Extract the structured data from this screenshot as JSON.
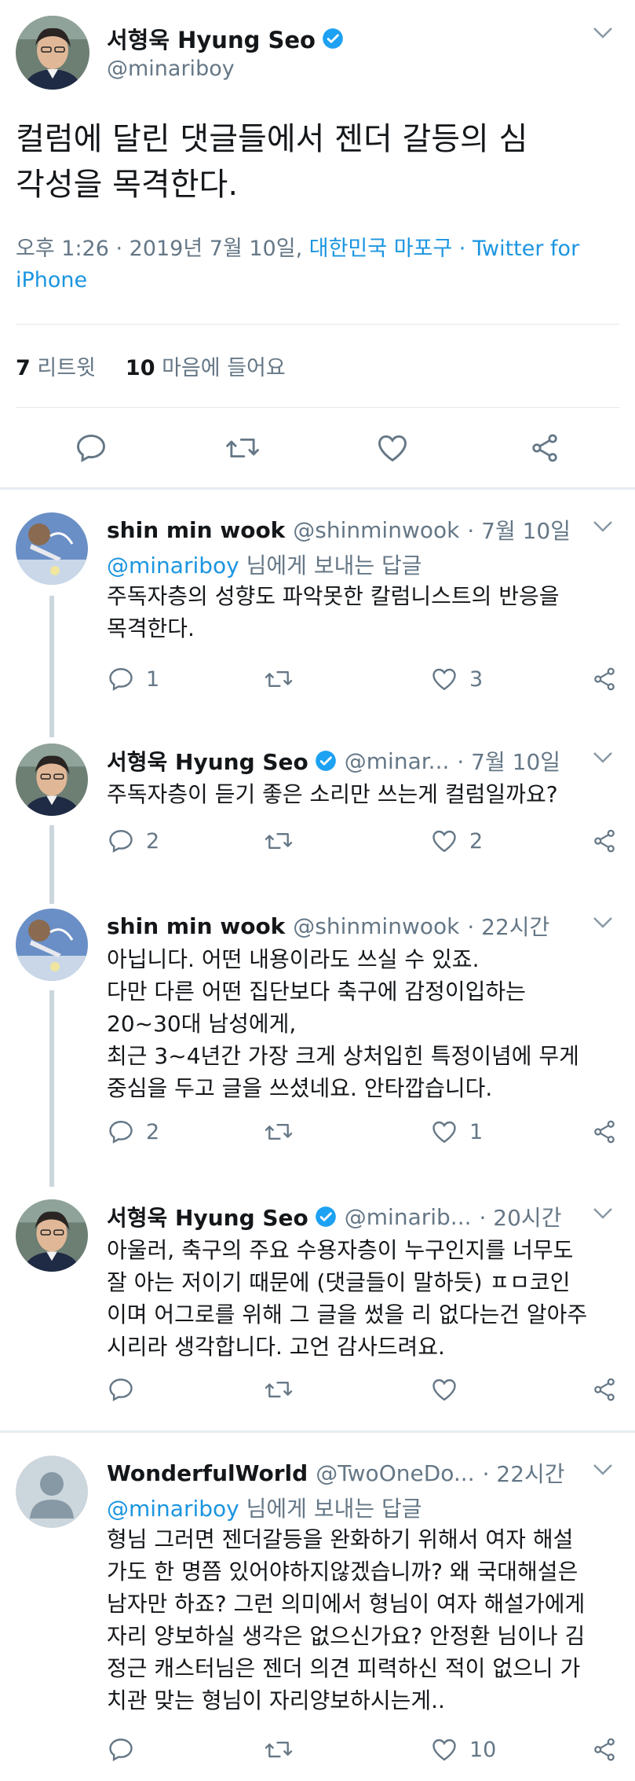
{
  "main_tweet": {
    "name": "서형욱 Hyung Seo",
    "handle": "@minariboy",
    "text_line1": "컬럼에 달린 댓글들에서 젠더 갈등의 심",
    "text_line2": "각성을 목격한다.",
    "meta_time": "오후 1:26 · 2019년 7월 10일, ",
    "meta_location": "대한민국 마포구",
    "meta_source": " · Twitter for iPhone",
    "retweet_count": "7",
    "retweet_label": "리트윗",
    "like_count": "10",
    "like_label": "마음에 들어요"
  },
  "replies": [
    {
      "name": "shin min wook",
      "handle": "@shinminwook",
      "time": "· 7월 10일",
      "replying_mention": "@minariboy",
      "replying_suffix": " 님에게 보내는 답글",
      "text": "주독자층의 성향도 파악못한 칼럼니스트의 반응을\n목격한다.",
      "reply_count": "1",
      "retweet_count": "",
      "like_count": "3"
    },
    {
      "name": "서형욱 Hyung Seo",
      "handle": "@minar...",
      "time": "· 7월 10일",
      "text": "주독자층이 듣기 좋은 소리만 쓰는게 컬럼일까요?",
      "reply_count": "2",
      "retweet_count": "",
      "like_count": "2"
    },
    {
      "name": "shin min wook",
      "handle": "@shinminwook",
      "time": "· 22시간",
      "text": "아닙니다. 어떤 내용이라도 쓰실 수 있죠.\n다만 다른 어떤 집단보다 축구에 감정이입하는\n20~30대 남성에게,\n최근 3~4년간 가장 크게 상처입힌 특정이념에 무게\n중심을 두고 글을 쓰셨네요. 안타깝습니다.",
      "reply_count": "2",
      "retweet_count": "",
      "like_count": "1"
    },
    {
      "name": "서형욱 Hyung Seo",
      "handle": "@minarib...",
      "time": "· 20시간",
      "text": "아울러, 축구의 주요 수용자층이 누구인지를 너무도\n잘 아는 저이기 때문에 (댓글들이 말하듯) ㅍㅁ코인\n이며 어그로를 위해 그 글을 썼을 리 없다는건 알아주\n시리라 생각합니다. 고언 감사드려요.",
      "reply_count": "",
      "retweet_count": "",
      "like_count": ""
    },
    {
      "name": "WonderfulWorld",
      "handle": "@TwoOneDo...",
      "time": "· 22시간",
      "replying_mention": "@minariboy",
      "replying_suffix": " 님에게 보내는 답글",
      "text": "형님 그러면 젠더갈등을 완화하기 위해서 여자 해설\n가도 한 명쯤 있어야하지않겠습니까? 왜 국대해설은\n남자만 하죠? 그런 의미에서 형님이 여자 해설가에게\n자리 양보하실 생각은 없으신가요? 안정환 님이나 김\n정근 캐스터님은 젠더 의견 피력하신 적이 없으니 가\n치관 맞는 형님이 자리양보하시는게..",
      "reply_count": "",
      "retweet_count": "",
      "like_count": "10"
    }
  ],
  "colors": {
    "text": "#14171a",
    "secondary": "#657786",
    "link": "#1b95e0",
    "verified": "#1da1f2",
    "divider": "#e1e8ed",
    "thread_line": "#ccd6dd"
  }
}
